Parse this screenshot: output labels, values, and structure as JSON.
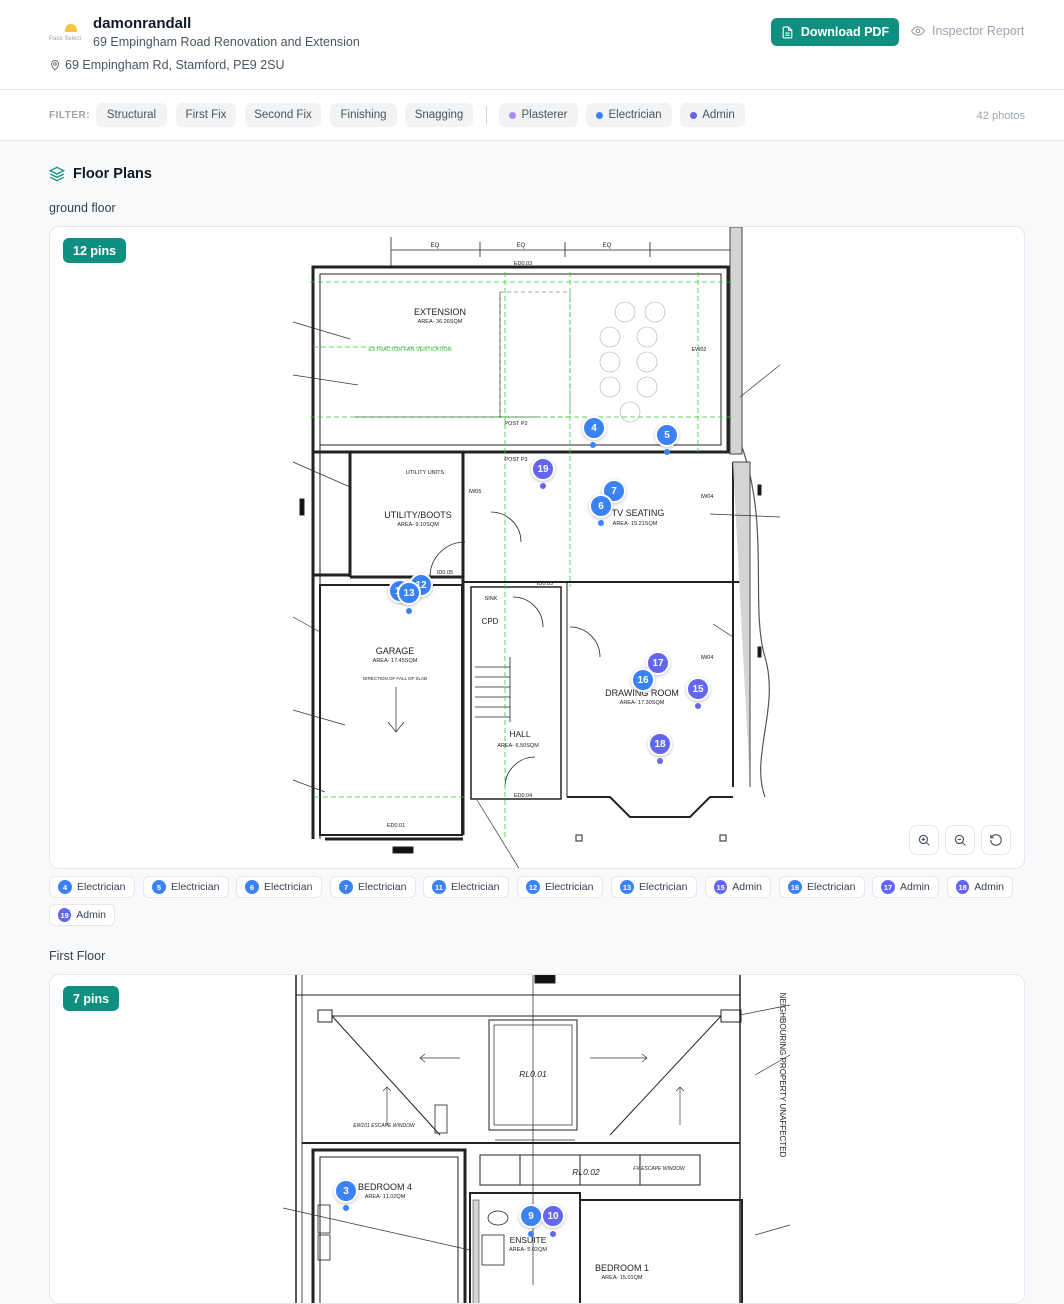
{
  "header": {
    "logo_text": "Pace Select",
    "company": "damonrandall",
    "project": "69 Empingham Road Renovation and Extension",
    "address": "69 Empingham Rd, Stamford, PE9 2SU",
    "download_label": "Download PDF",
    "inspector_label": "Inspector Report"
  },
  "filter": {
    "label": "FILTER:",
    "stages": [
      "Structural",
      "First Fix",
      "Second Fix",
      "Finishing",
      "Snagging"
    ],
    "roles": [
      {
        "label": "Plasterer",
        "color": "#a78bfa"
      },
      {
        "label": "Electrician",
        "color": "#3b82f6"
      },
      {
        "label": "Admin",
        "color": "#6366f1"
      }
    ],
    "photo_count": "42 photos"
  },
  "section": {
    "title": "Floor Plans"
  },
  "colors": {
    "accent": "#0f8f80",
    "electrician": "#3b82f6",
    "admin": "#6366f1"
  },
  "floors": [
    {
      "name": "ground floor",
      "pins_label": "12 pins",
      "plan_labels": {
        "extension": "EXTENSION",
        "extension_area": "AREA- 36.26SQM",
        "extractor": "EXTRACTOR FAN VENTILATION",
        "utility_units": "UTILITY UNITS",
        "utility": "UTILITY/BOOTS",
        "utility_area": "AREA- 9.10SQM",
        "tv": "TV  SEATING",
        "tv_area": "AREA- 15.21SQM",
        "garage": "GARAGE",
        "garage_area": "AREA- 17.45SQM",
        "slab": "DIRECTION OF FALL OF SLAB",
        "cpd": "CPD",
        "sink": "SINK",
        "hall": "HALL",
        "hall_area": "AREA- 6.50SQM",
        "drawing": "DRAWING ROOM",
        "drawing_area": "AREA- 17.30SQM",
        "eq": "EQ",
        "ed003": "ED0.03",
        "post_p2": "POST P2",
        "post_p3": "POST P3",
        "iw05": "IW05",
        "iw04": "IW04",
        "ew02": "EW02",
        "id005": "ID0.05",
        "id003": "ID0.03",
        "ed004": "ED0.04",
        "ed001": "ED0.01"
      },
      "pins": [
        {
          "n": "4",
          "role": "Electrician"
        },
        {
          "n": "5",
          "role": "Electrician"
        },
        {
          "n": "6",
          "role": "Electrician"
        },
        {
          "n": "7",
          "role": "Electrician"
        },
        {
          "n": "11",
          "role": "Electrician"
        },
        {
          "n": "12",
          "role": "Electrician"
        },
        {
          "n": "13",
          "role": "Electrician"
        },
        {
          "n": "15",
          "role": "Admin"
        },
        {
          "n": "16",
          "role": "Electrician"
        },
        {
          "n": "17",
          "role": "Admin"
        },
        {
          "n": "18",
          "role": "Admin"
        },
        {
          "n": "19",
          "role": "Admin"
        }
      ]
    },
    {
      "name": "First Floor",
      "pins_label": "7 pins",
      "plan_labels": {
        "rl001": "RL0.01",
        "rl002": "RL0.02",
        "escape": "EW101 ESCAPE WINDOW",
        "fx_escape": "FX ESCAPE WINDOW",
        "bedroom4": "BEDROOM 4",
        "bedroom4_area": "AREA- 11.02QM",
        "ensuite": "ENSUITE",
        "ensuite_area": "AREA- 5.02QM",
        "bedroom1": "BEDROOM 1",
        "bedroom1_area": "AREA- 15.01QM",
        "neighbouring": "NEIGHBOURING PROPERTY UNAFFECTED"
      },
      "pins": [
        {
          "n": "3",
          "role": "Electrician"
        },
        {
          "n": "9",
          "role": "Electrician"
        },
        {
          "n": "10",
          "role": "Admin"
        }
      ]
    }
  ]
}
